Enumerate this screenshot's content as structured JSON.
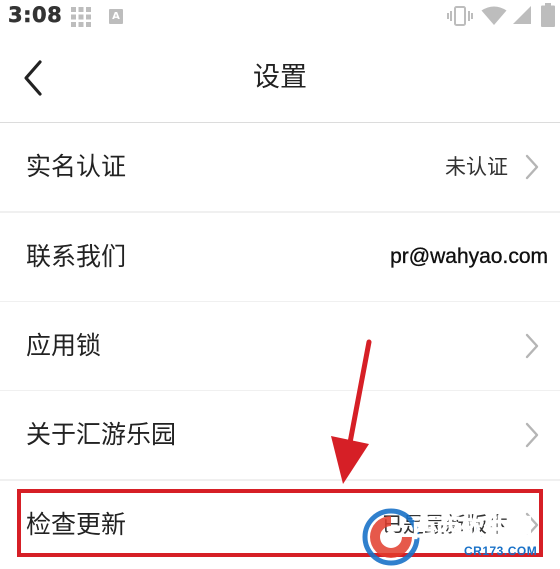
{
  "status_bar": {
    "time": "3:08",
    "icons": [
      "grid-icon",
      "a-icon",
      "vibrate-icon",
      "wifi-icon",
      "signal-icon",
      "battery-icon"
    ],
    "a_icon_letter": "A"
  },
  "header": {
    "title": "设置",
    "back_icon": "chevron-left-icon"
  },
  "settings": {
    "items": [
      {
        "label": "实名认证",
        "value": "未认证",
        "has_chevron": true
      },
      {
        "label": "联系我们",
        "value": "pr@wahyao.com",
        "has_chevron": false
      },
      {
        "label": "应用锁",
        "value": "",
        "has_chevron": true
      },
      {
        "label": "关于汇游乐园",
        "value": "",
        "has_chevron": true
      },
      {
        "label": "检查更新",
        "value": "已是最新版本",
        "has_chevron": true
      }
    ]
  },
  "annotation": {
    "highlight_color": "#d61f26",
    "highlighted_item": "检查更新"
  },
  "watermark": {
    "brand": "西西",
    "rest": "软件园",
    "domain": "CR173.COM"
  },
  "colors": {
    "background": "#f0f0f0",
    "row_background": "#ffffff",
    "divider": "#dcdcdc",
    "chevron": "#b5b5b5",
    "annotation_red": "#d61f26"
  }
}
